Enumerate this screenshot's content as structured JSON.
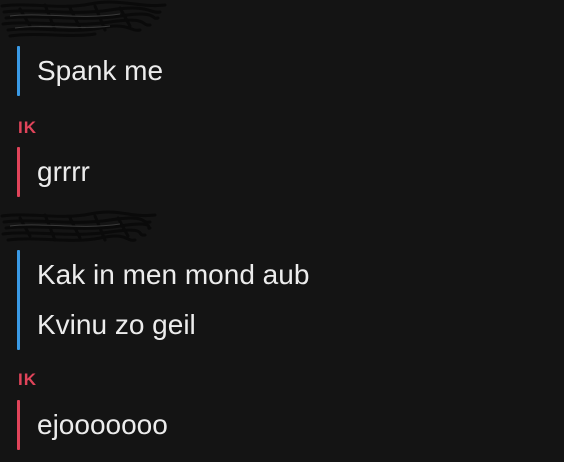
{
  "colors": {
    "background": "#141414",
    "me": "#e0445a",
    "other": "#3a9ae6",
    "text": "#ececec"
  },
  "messages": [
    {
      "sender": "",
      "sender_redacted": true,
      "side": "other",
      "lines": [
        "Spank me"
      ]
    },
    {
      "sender": "IK",
      "sender_redacted": false,
      "side": "me",
      "lines": [
        "grrrr"
      ]
    },
    {
      "sender": "",
      "sender_redacted": true,
      "side": "other",
      "lines": [
        "Kak in men mond aub",
        "Kvinu zo geil"
      ]
    },
    {
      "sender": "IK",
      "sender_redacted": false,
      "side": "me",
      "lines": [
        "ejooooooo"
      ]
    }
  ]
}
